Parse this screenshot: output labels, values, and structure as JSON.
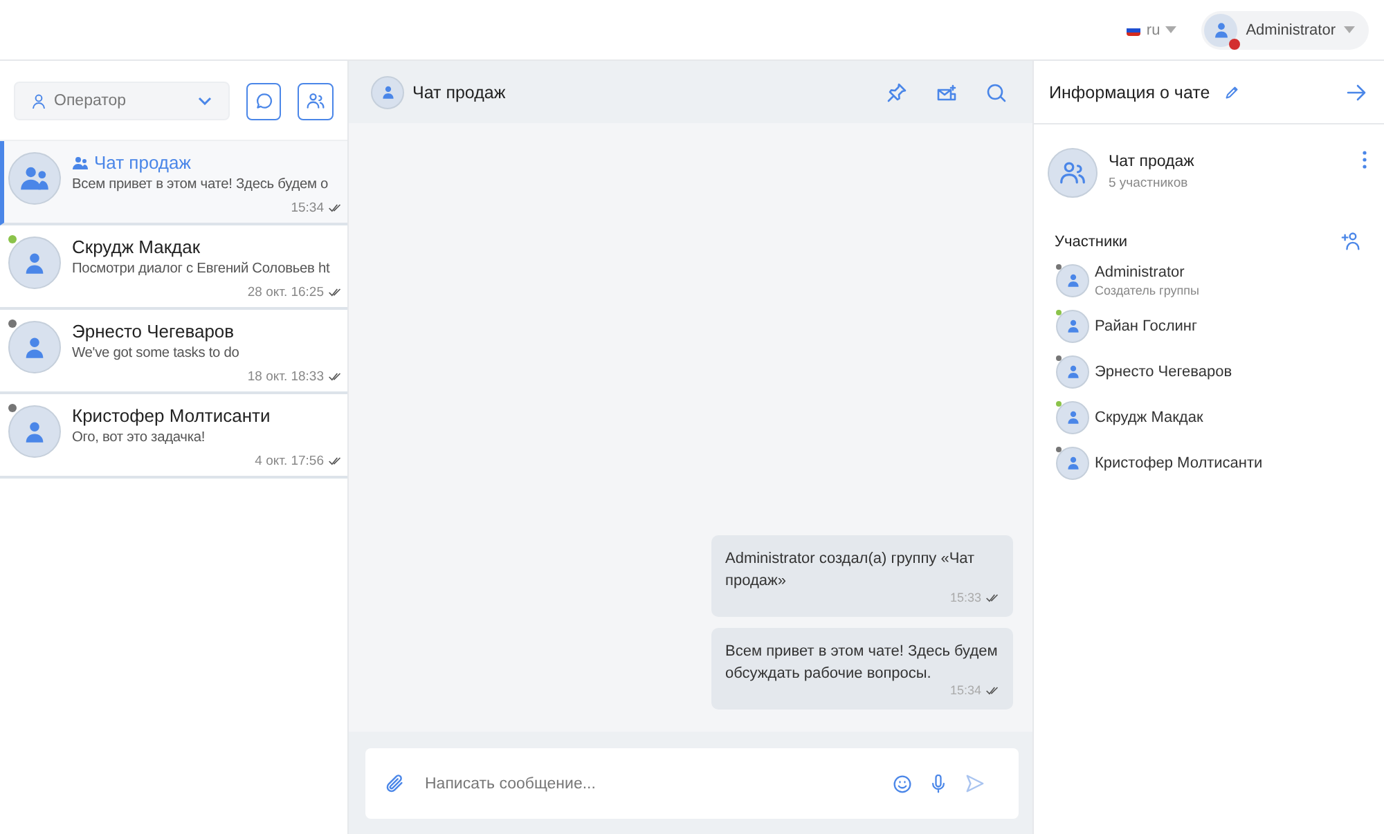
{
  "topbar": {
    "language": "ru",
    "user": {
      "name": "Administrator",
      "color": "#d32f2f"
    }
  },
  "sidebar": {
    "filter": {
      "value": "Оператор"
    },
    "chats": [
      {
        "kind": "group",
        "name": "Чат продаж",
        "preview": "Всем привет в этом чате! Здесь будем о",
        "time": "15:34",
        "selected": true
      },
      {
        "kind": "person",
        "name": "Скрудж Макдак",
        "preview": "Посмотри диалог с Евгений Соловьев ht",
        "time": "28 окт. 16:25",
        "selected": false,
        "color": "#8bc34a"
      },
      {
        "kind": "person",
        "name": "Эрнесто Чегеваров",
        "preview": "We've got some tasks to do",
        "time": "18 окт. 18:33",
        "selected": false,
        "color": "#757575"
      },
      {
        "kind": "person",
        "name": "Кристофер Молтисанти",
        "preview": "Ого, вот это задачка!",
        "time": "4 окт. 17:56",
        "selected": false,
        "color": "#757575"
      }
    ]
  },
  "chat": {
    "title": "Чат продаж",
    "messages": [
      {
        "text": "Administrator создал(а) группу «Чат продаж»",
        "time": "15:33"
      },
      {
        "text": "Всем привет в этом чате! Здесь будем обсуждать рабочие вопросы.",
        "time": "15:34"
      }
    ],
    "composer": {
      "placeholder": "Написать сообщение..."
    }
  },
  "info": {
    "title": "Информация о чате",
    "group_name": "Чат продаж",
    "member_count": "5 участников",
    "members_heading": "Участники",
    "members": [
      {
        "name": "Administrator",
        "role": "Создатель группы",
        "color": "#757575"
      },
      {
        "name": "Райан Гослинг",
        "color": "#8bc34a"
      },
      {
        "name": "Эрнесто Чегеваров",
        "color": "#757575"
      },
      {
        "name": "Скрудж Макдак",
        "color": "#8bc34a"
      },
      {
        "name": "Кристофер Молтисанти",
        "color": "#757575"
      }
    ]
  }
}
